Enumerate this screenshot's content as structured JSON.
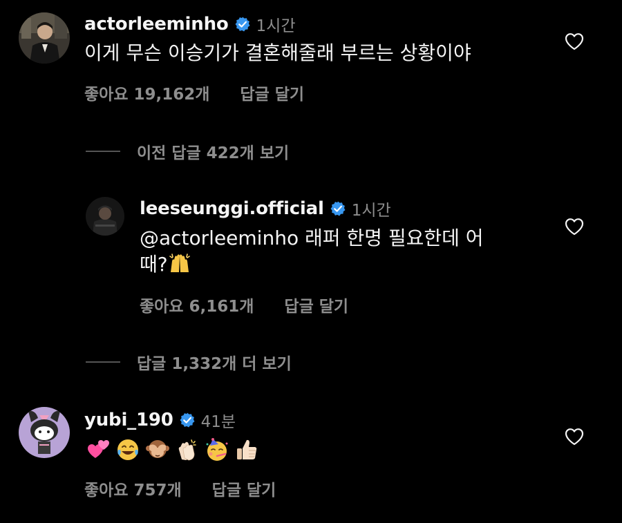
{
  "colors": {
    "background": "#000000",
    "primary_text": "#f5f5f5",
    "secondary_text": "#8e8e8e",
    "verified_badge": "#3897f0"
  },
  "comments": [
    {
      "username": "actorleeminho",
      "verified": true,
      "time": "1시간",
      "text": "이게 무슨 이승기가 결혼해줄래 부르는 상황이야",
      "likes": "좋아요 19,162개",
      "reply_label": "답글 달기"
    },
    {
      "username": "yubi_190",
      "verified": true,
      "time": "41분",
      "emojis": [
        "heart-pair-emoji",
        "laughing-tears-emoji",
        "see-no-evil-monkey-emoji",
        "clapping-hands-emoji",
        "party-face-emoji",
        "thumbs-up-emoji"
      ],
      "likes": "좋아요 757개",
      "reply_label": "답글 달기"
    }
  ],
  "thread": {
    "view_previous": "이전 답글 422개 보기",
    "view_more": "답글 1,332개 더 보기"
  },
  "reply": {
    "username": "leeseunggi.official",
    "verified": true,
    "time": "1시간",
    "text_line1": "@actorleeminho 래퍼 한명 필요한데 어",
    "text_line2": "때?",
    "inline_emoji": "raising-hands-emoji",
    "likes": "좋아요 6,161개",
    "reply_label": "답글 달기"
  }
}
